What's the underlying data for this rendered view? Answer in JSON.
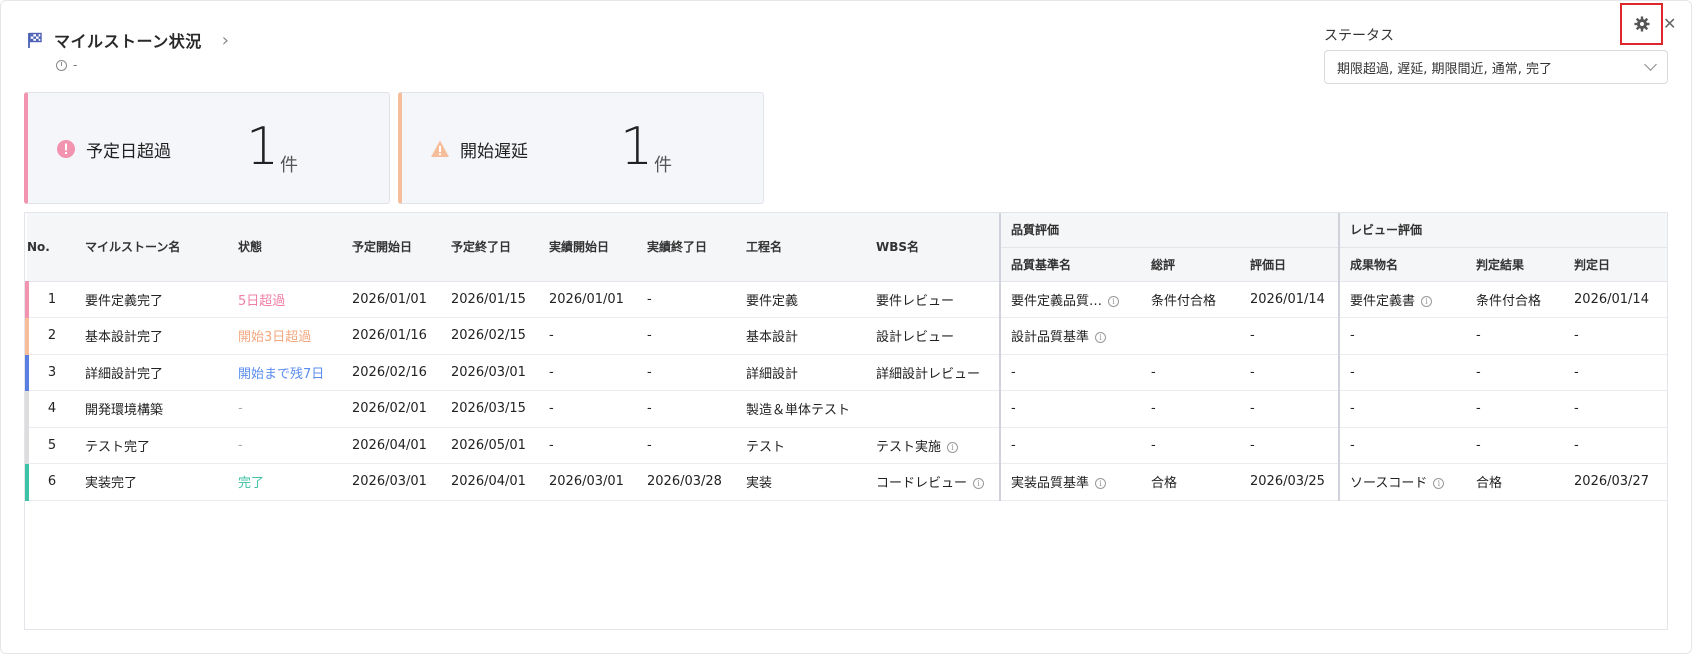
{
  "header": {
    "title": "マイルストーン状況",
    "updated": "-"
  },
  "status_filter": {
    "label": "ステータス",
    "selected": "期限超過, 遅延, 期限間近, 通常, 完了"
  },
  "cards": [
    {
      "label": "予定日超過",
      "count": "1",
      "unit": "件",
      "color": "#f294b0"
    },
    {
      "label": "開始遅延",
      "count": "1",
      "unit": "件",
      "color": "#f6bd9b"
    }
  ],
  "table": {
    "groups": {
      "quality": "品質評価",
      "review": "レビュー評価"
    },
    "columns": {
      "no": "No.",
      "name": "マイルストーン名",
      "state": "状態",
      "plan_start": "予定開始日",
      "plan_end": "予定終了日",
      "actual_start": "実績開始日",
      "actual_end": "実績終了日",
      "process": "工程名",
      "wbs": "WBS名",
      "q_std": "品質基準名",
      "q_total": "総評",
      "q_date": "評価日",
      "r_item": "成果物名",
      "r_result": "判定結果",
      "r_date": "判定日"
    },
    "rows": [
      {
        "no": "1",
        "name": "要件定義完了",
        "state": "5日超過",
        "plan_start": "2026/01/01",
        "plan_end": "2026/01/15",
        "actual_start": "2026/01/01",
        "actual_end": "-",
        "process": "要件定義",
        "wbs": "要件レビュー",
        "q_std": "要件定義品質…",
        "q_total": "条件付合格",
        "q_date": "2026/01/14",
        "r_item": "要件定義書",
        "r_result": "条件付合格",
        "r_date": "2026/01/14",
        "color": "#f294b0"
      },
      {
        "no": "2",
        "name": "基本設計完了",
        "state": "開始3日超過",
        "plan_start": "2026/01/16",
        "plan_end": "2026/02/15",
        "actual_start": "-",
        "actual_end": "-",
        "process": "基本設計",
        "wbs": "設計レビュー",
        "q_std": "設計品質基準",
        "q_total": "",
        "q_date": "-",
        "r_item": "-",
        "r_result": "-",
        "r_date": "-",
        "color": "#f6bd9b"
      },
      {
        "no": "3",
        "name": "詳細設計完了",
        "state": "開始まで残7日",
        "plan_start": "2026/02/16",
        "plan_end": "2026/03/01",
        "actual_start": "-",
        "actual_end": "-",
        "process": "詳細設計",
        "wbs": "詳細設計レビュー",
        "q_std": "-",
        "q_total": "-",
        "q_date": "-",
        "r_item": "-",
        "r_result": "-",
        "r_date": "-",
        "color": "#5b7fe0"
      },
      {
        "no": "4",
        "name": "開発環境構築",
        "state": "-",
        "plan_start": "2026/02/01",
        "plan_end": "2026/03/15",
        "actual_start": "-",
        "actual_end": "-",
        "process": "製造＆単体テスト",
        "wbs": "",
        "q_std": "-",
        "q_total": "-",
        "q_date": "-",
        "r_item": "-",
        "r_result": "-",
        "r_date": "-",
        "color": "#dddddd"
      },
      {
        "no": "5",
        "name": "テスト完了",
        "state": "-",
        "plan_start": "2026/04/01",
        "plan_end": "2026/05/01",
        "actual_start": "-",
        "actual_end": "-",
        "process": "テスト",
        "wbs": "テスト実施",
        "q_std": "-",
        "q_total": "-",
        "q_date": "-",
        "r_item": "-",
        "r_result": "-",
        "r_date": "-",
        "color": "#dddddd"
      },
      {
        "no": "6",
        "name": "実装完了",
        "state": "完了",
        "plan_start": "2026/03/01",
        "plan_end": "2026/04/01",
        "actual_start": "2026/03/01",
        "actual_end": "2026/03/28",
        "process": "実装",
        "wbs": "コードレビュー",
        "q_std": "実装品質基準",
        "q_total": "合格",
        "q_date": "2026/03/25",
        "r_item": "ソースコード",
        "r_result": "合格",
        "r_date": "2026/03/27",
        "color": "#3ec2a5"
      }
    ]
  }
}
